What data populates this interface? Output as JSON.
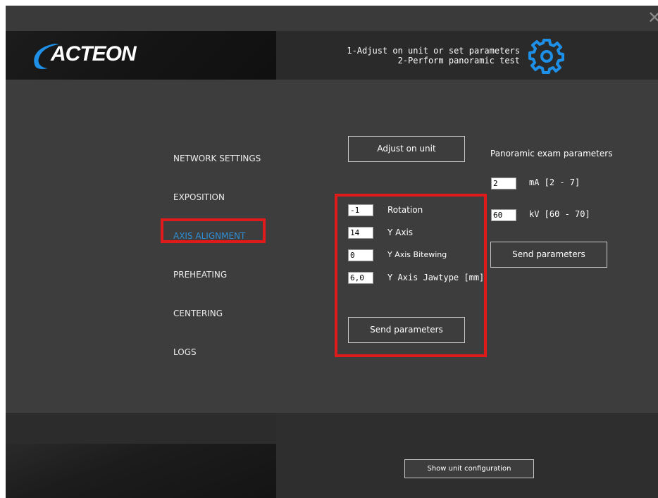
{
  "window": {
    "close_glyph": "✕"
  },
  "header": {
    "logo_text": "ACTEON",
    "steps": [
      "1-Adjust on unit or set parameters",
      "2-Perform panoramic test"
    ],
    "icon": "gear-icon",
    "accent_color": "#1e90e8"
  },
  "nav": {
    "items": [
      {
        "label": "NETWORK SETTINGS",
        "active": false
      },
      {
        "label": "EXPOSITION",
        "active": false
      },
      {
        "label": "AXIS ALIGNMENT",
        "active": true
      },
      {
        "label": "PREHEATING",
        "active": false
      },
      {
        "label": "CENTERING",
        "active": false
      },
      {
        "label": "LOGS",
        "active": false
      }
    ],
    "active_color": "#2f8fd6"
  },
  "axis": {
    "adjust_label": "Adjust on unit",
    "fields": [
      {
        "value": "-1",
        "label": "Rotation"
      },
      {
        "value": "14",
        "label": "Y Axis"
      },
      {
        "value": "0",
        "label": "Y Axis Bitewing"
      },
      {
        "value": "6,0",
        "label": "Y Axis Jawtype [mm]"
      }
    ],
    "send_label": "Send parameters"
  },
  "pano": {
    "title": "Panoramic exam parameters",
    "fields": [
      {
        "value": "2",
        "label": "mA [2 - 7]"
      },
      {
        "value": "60",
        "label": "kV [60 - 70]"
      }
    ],
    "send_label": "Send parameters"
  },
  "footer": {
    "config_label": "Show unit configuration"
  },
  "highlight_color": "#e0191b"
}
